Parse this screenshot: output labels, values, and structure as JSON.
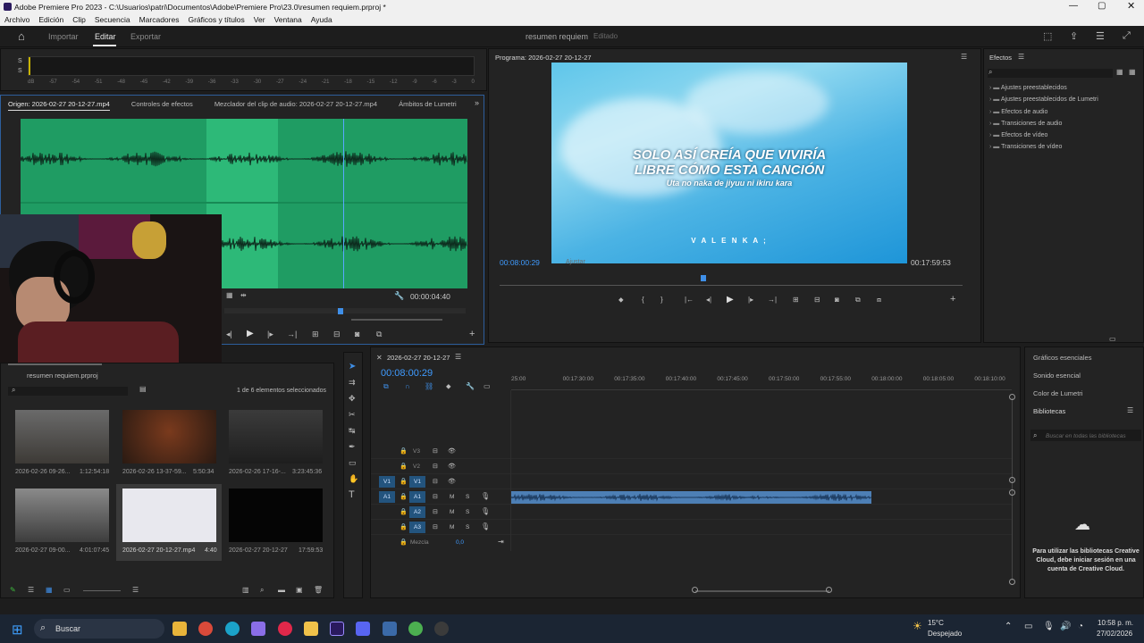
{
  "window": {
    "title": "Adobe Premiere Pro 2023 - C:\\Usuarios\\patri\\Documentos\\Adobe\\Premiere Pro\\23.0\\resumen requiem.prproj *"
  },
  "menu": [
    "Archivo",
    "Edición",
    "Clip",
    "Secuencia",
    "Marcadores",
    "Gráficos y títulos",
    "Ver",
    "Ventana",
    "Ayuda"
  ],
  "header": {
    "tabs": [
      "Importar",
      "Editar",
      "Exportar"
    ],
    "active_tab": "Editar",
    "project": "resumen requiem",
    "status": "Editado"
  },
  "audio_meter": {
    "channels": [
      "S",
      "S"
    ],
    "scale": [
      "dB",
      "-57",
      "-54",
      "-51",
      "-48",
      "-45",
      "-42",
      "-39",
      "-36",
      "-33",
      "-30",
      "-27",
      "-24",
      "-21",
      "-18",
      "-15",
      "-12",
      "-9",
      "-6",
      "-3",
      "0"
    ]
  },
  "source": {
    "tabs": [
      "Origen: 2026-02-27 20-12-27.mp4",
      "Controles de efectos",
      "Mezclador del clip de audio: 2026-02-27 20-12-27.mp4",
      "Ámbitos de Lumetri"
    ],
    "timecode": "00:00:04:40"
  },
  "program": {
    "title": "Programa: 2026-02-27 20-12-27",
    "timecode": "00:08:00:29",
    "duration": "00:17:59:53",
    "fit": "Ajustar",
    "lyric_line1": "SOLO ASÍ CREÍA QUE VIVIRÍA",
    "lyric_line2": "LIBRE CÓMO ESTA CANCIÓN",
    "lyric_sub": "Uta no naka de jiyuu ni ikiru kara",
    "credit": "V A L E N K A ;"
  },
  "effects": {
    "title": "Efectos",
    "items": [
      "Ajustes preestablecidos",
      "Ajustes preestablecidos de Lumetri",
      "Efectos de audio",
      "Transiciones de audio",
      "Efectos de vídeo",
      "Transiciones de vídeo"
    ]
  },
  "right_panels": [
    "Gráficos esenciales",
    "Sonido esencial",
    "Color de Lumetri",
    "Bibliotecas"
  ],
  "libraries": {
    "search_placeholder": "Buscar en todas las bibliotecas",
    "message": "Para utilizar las bibliotecas Creative Cloud, debe iniciar sesión en una cuenta de Creative Cloud."
  },
  "project_panel": {
    "name": "resumen requiem.prproj",
    "selection": "1 de 6 elementos seleccionados",
    "items": [
      {
        "name": "2026-02-26 09-26...",
        "duration": "1:12:54:18"
      },
      {
        "name": "2026-02-26 13-37-59...",
        "duration": "5:50:34"
      },
      {
        "name": "2026-02-26 17-16-...",
        "duration": "3:23:45:36"
      },
      {
        "name": "2026-02-27 09-00...",
        "duration": "4:01:07:45"
      },
      {
        "name": "2026-02-27 20-12-27.mp4",
        "duration": "4:40"
      },
      {
        "name": "2026-02-27 20-12-27",
        "duration": "17:59:53"
      }
    ]
  },
  "timeline": {
    "sequence": "2026-02-27 20-12-27",
    "timecode": "00:08:00:29",
    "ruler": [
      "25:00",
      "00:17:30:00",
      "00:17:35:00",
      "00:17:40:00",
      "00:17:45:00",
      "00:17:50:00",
      "00:17:55:00",
      "00:18:00:00",
      "00:18:05:00",
      "00:18:10:00"
    ],
    "video_tracks": [
      "V3",
      "V2",
      "V1"
    ],
    "audio_tracks": [
      "A1",
      "A2",
      "A3"
    ],
    "mix_label": "Mezcla",
    "mix_value": "0,0"
  },
  "taskbar": {
    "search": "Buscar",
    "weather_temp": "15°C",
    "weather_desc": "Despejado",
    "time": "10:58 p. m.",
    "date": "27/02/2026"
  }
}
